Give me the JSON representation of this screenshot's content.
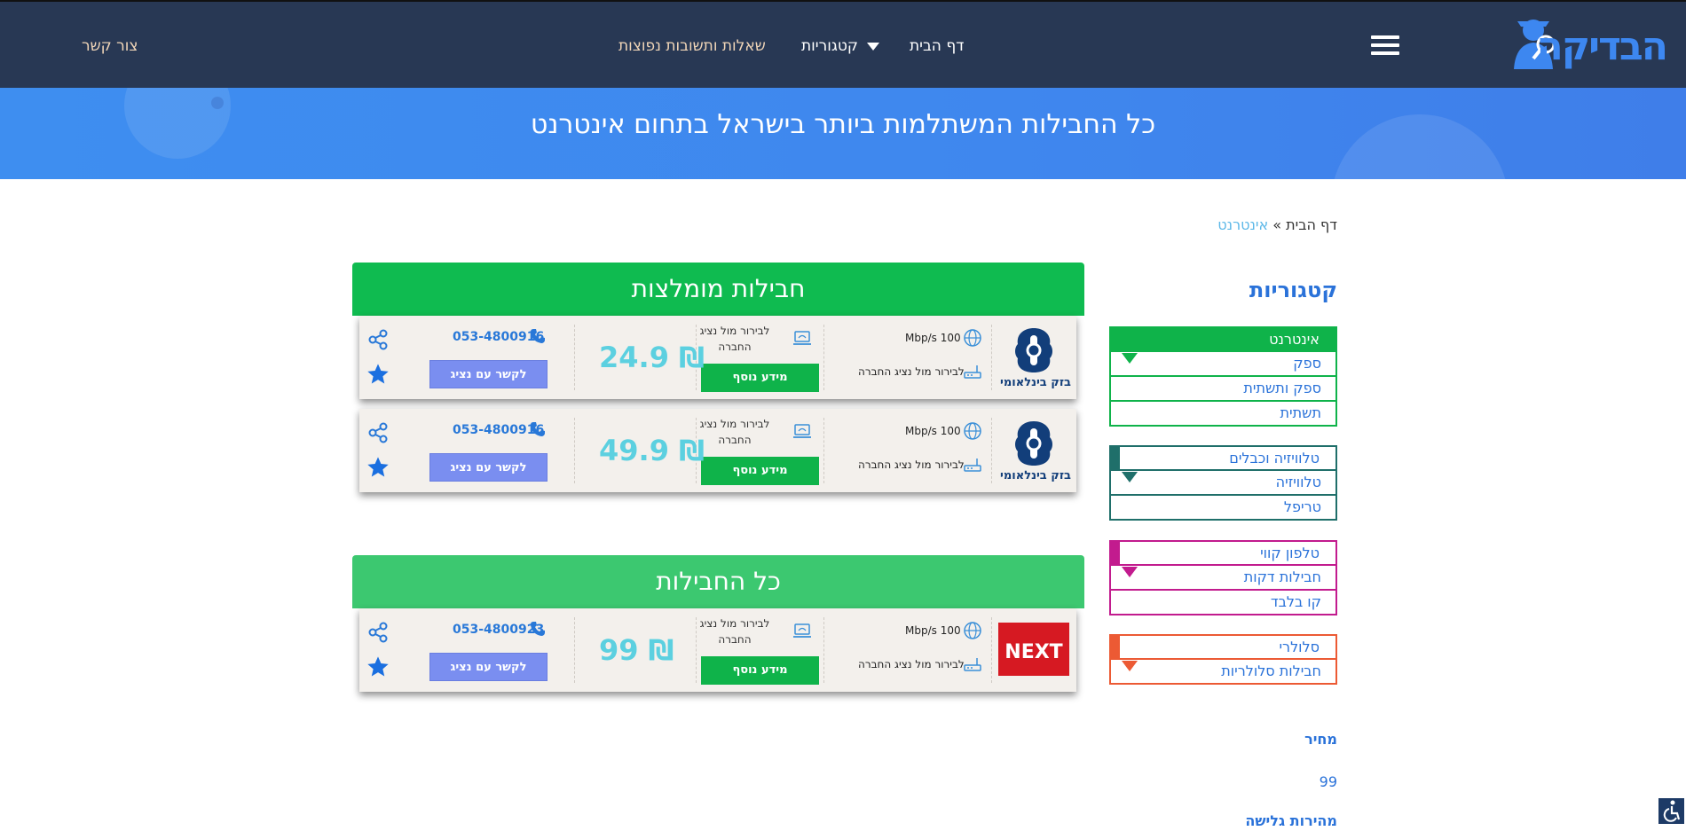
{
  "header": {
    "logo_text": "הבדיקה",
    "nav": {
      "home": "דף הבית",
      "categories": "קטגוריות",
      "faq": "שאלות ותשובות נפוצות",
      "contact": "צור קשר"
    }
  },
  "hero": {
    "title": "כל החבילות המשתלמות ביותר בישראל בתחום אינטרנט"
  },
  "breadcrumb": {
    "home": "דף הבית",
    "separator": "»",
    "current": "אינטרנט"
  },
  "sidebar": {
    "title": "קטגוריות",
    "groups": [
      {
        "label": "אינטרנט",
        "color": "#0fb34a",
        "items": [
          "ספק",
          "ספק ותשתית",
          "תשתית"
        ]
      },
      {
        "label": "טלוויזיה וכבלים",
        "color": "#1f6f6a",
        "items": [
          "טלוויזיה",
          "טריפל"
        ]
      },
      {
        "label": "טלפון קווי",
        "color": "#c21b8e",
        "items": [
          "חבילות דקות",
          "קו בלבד"
        ]
      },
      {
        "label": "סלולרי",
        "color": "#ec5a34",
        "items": [
          "חבילות סלולריות"
        ]
      }
    ],
    "filters": {
      "price_label": "מחיר",
      "price_value": "99",
      "speed_label": "מהירות גלישה"
    }
  },
  "recommended": {
    "title": "חבילות מומלצות",
    "packages": [
      {
        "brand": "בזק בינלאומי",
        "speed": "Mbp/s 100",
        "router": "לבירור מול נציג החברה",
        "note": "לבירור מול נציג החברה",
        "more": "מידע נוסף",
        "price": "24.9",
        "currency": "₪",
        "phone": "053-4800916",
        "contact": "לקשר עם נציג"
      },
      {
        "brand": "בזק בינלאומי",
        "speed": "Mbp/s 100",
        "router": "לבירור מול נציג החברה",
        "note": "לבירור מול נציג החברה",
        "more": "מידע נוסף",
        "price": "49.9",
        "currency": "₪",
        "phone": "053-4800916",
        "contact": "לקשר עם נציג"
      }
    ]
  },
  "all": {
    "title": "כל החבילות",
    "packages": [
      {
        "brand": "NEXT",
        "speed": "Mbp/s 100",
        "router": "לבירור מול נציג החברה",
        "note": "לבירור מול נציג החברה",
        "more": "מידע נוסף",
        "price": "99",
        "currency": "₪",
        "phone": "053-4800923",
        "contact": "לקשר עם נציג"
      }
    ]
  },
  "colors": {
    "header_bg": "#283854",
    "hero_bg": "#3e8ef0",
    "green": "#0fb34a",
    "section_green": "#3cc870",
    "price": "#5cd0e0",
    "contact_btn": "#7a8ef0",
    "link_blue": "#2a72d9"
  }
}
